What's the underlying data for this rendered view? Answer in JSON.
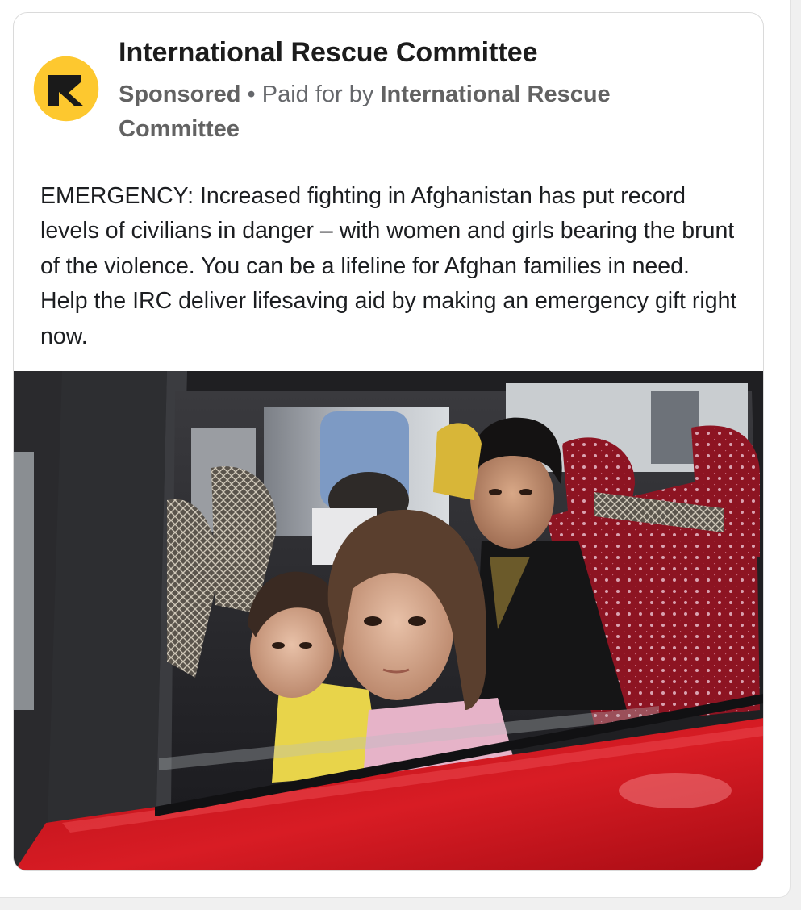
{
  "post": {
    "page_name": "International Rescue Committee",
    "sponsored_label": "Sponsored",
    "separator": " • ",
    "paid_for_prefix": "Paid for by ",
    "paid_for_name": "International Rescue Committee",
    "body": "EMERGENCY: Increased fighting in Afghanistan has put record levels of civilians in danger – with women and girls bearing the brunt of the violence. You can be a lifeline for Afghan families in need. Help the IRC deliver lifesaving aid by making an emergency gift right now.",
    "avatar_icon": "irc-logo-icon",
    "image_icon": "children-in-red-car-photo"
  },
  "colors": {
    "brand_yellow": "#fdc82f",
    "brand_black": "#1a1a1a",
    "car_red": "#c8141c"
  }
}
